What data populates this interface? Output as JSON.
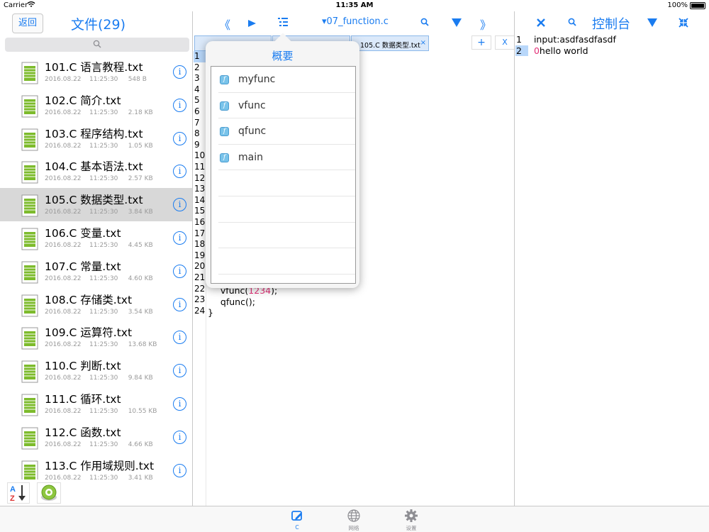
{
  "status_bar": {
    "carrier": "Carrier",
    "time": "11:35 AM",
    "battery": "100%"
  },
  "left": {
    "back_label": "返回",
    "title": "文件(29)",
    "files": [
      {
        "name": "101.C 语言教程.txt",
        "meta": "2016.08.22    11:25:30     548 B"
      },
      {
        "name": "102.C 简介.txt",
        "meta": "2016.08.22    11:25:30     2.18 KB"
      },
      {
        "name": "103.C 程序结构.txt",
        "meta": "2016.08.22    11:25:30     1.05 KB"
      },
      {
        "name": "104.C 基本语法.txt",
        "meta": "2016.08.22    11:25:30     2.57 KB"
      },
      {
        "name": "105.C 数据类型.txt",
        "meta": "2016.08.22    11:25:30     3.84 KB"
      },
      {
        "name": "106.C 变量.txt",
        "meta": "2016.08.22    11:25:30     4.45 KB"
      },
      {
        "name": "107.C 常量.txt",
        "meta": "2016.08.22    11:25:30     4.60 KB"
      },
      {
        "name": "108.C 存储类.txt",
        "meta": "2016.08.22    11:25:30     3.54 KB"
      },
      {
        "name": "109.C 运算符.txt",
        "meta": "2016.08.22    11:25:30     13.68 KB"
      },
      {
        "name": "110.C 判断.txt",
        "meta": "2016.08.22    11:25:30     9.84 KB"
      },
      {
        "name": "111.C 循环.txt",
        "meta": "2016.08.22    11:25:30     10.55 KB"
      },
      {
        "name": "112.C 函数.txt",
        "meta": "2016.08.22    11:25:30     4.66 KB"
      },
      {
        "name": "113.C 作用域规则.txt",
        "meta": "2016.08.22    11:25:30     3.41 KB"
      }
    ],
    "selected_index": 4
  },
  "editor": {
    "file_title": "▾07_function.c",
    "tabs": [
      {
        "label": ""
      },
      {
        "label": ""
      },
      {
        "label": "105.C 数据类型.txt"
      }
    ],
    "tab_close": "×",
    "add_label": "+",
    "x_label": "X",
    "line_numbers": [
      "1",
      "2",
      "3",
      "4",
      "5",
      "6",
      "7",
      "8",
      "9",
      "10",
      "11",
      "12",
      "13",
      "14",
      "15",
      "16",
      "17",
      "18",
      "19",
      "20",
      "21",
      "22",
      "23",
      "24"
    ],
    "code": {
      "l22_pre": "    vfunc(",
      "l22_num": "1234",
      "l22_post": ");",
      "l23": "    qfunc();",
      "l24": "}"
    }
  },
  "outline": {
    "title": "概要",
    "badge": "f",
    "items": [
      "myfunc",
      "vfunc",
      "qfunc",
      "main"
    ]
  },
  "console": {
    "title": "控制台",
    "lines": [
      {
        "no": "1",
        "text": "input:asdfasdfasdf"
      },
      {
        "no": "2",
        "prefix": "0",
        "text": "hello world"
      }
    ]
  },
  "tabbar": {
    "items": [
      "C",
      "网络",
      "设置"
    ]
  },
  "colors": {
    "accent": "#1a7cf0",
    "number": "#e33077",
    "line_highlight": "#b8d7fa",
    "selected_row": "#d8d8d8"
  }
}
